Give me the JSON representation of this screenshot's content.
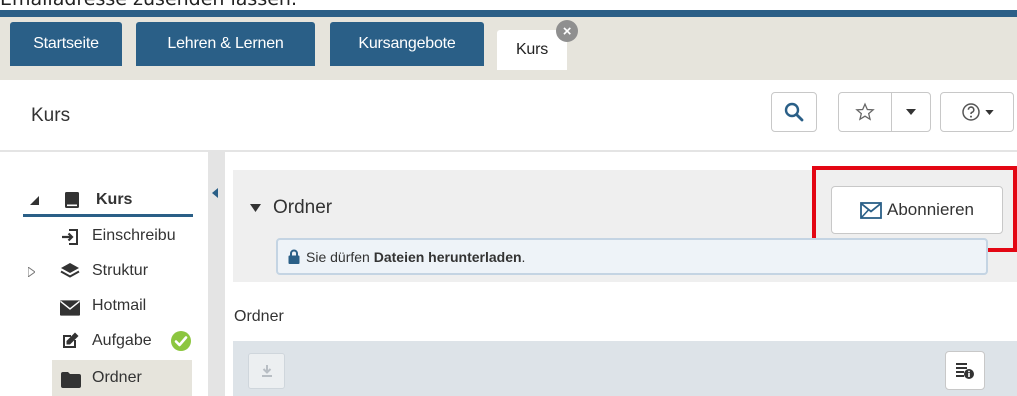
{
  "doc_caption": "Emailadresse zusenden lassen.",
  "tabs": [
    {
      "label": "Startseite"
    },
    {
      "label": "Lehren & Lernen"
    },
    {
      "label": "Kursangebote"
    },
    {
      "label": "Kurs",
      "active": true,
      "close": "×"
    }
  ],
  "toolbar": {
    "title": "Kurs",
    "search_icon": "search-icon",
    "bookmark_icon": "star-icon",
    "help_icon": "help-icon"
  },
  "tree": {
    "root": {
      "label": "Kurs",
      "icon": "book-icon"
    },
    "items": [
      {
        "label": "Einschreibu",
        "icon": "sign-in-icon"
      },
      {
        "label": "Struktur",
        "icon": "layers-icon",
        "expandable": true
      },
      {
        "label": "Hotmail",
        "icon": "envelope-icon"
      },
      {
        "label": "Aufgabe",
        "icon": "edit-icon",
        "status": "done"
      },
      {
        "label": "Ordner",
        "icon": "folder-icon",
        "selected": true
      }
    ]
  },
  "folder": {
    "title": "Ordner",
    "subscribe_label": "Abonnieren",
    "info_prefix": "Sie dürfen ",
    "info_bold": "Dateien herunterladen",
    "info_suffix": ".",
    "section_label": "Ordner"
  },
  "colors": {
    "brand": "#2a5f87",
    "highlight": "#e30613",
    "success": "#8cc63f"
  }
}
